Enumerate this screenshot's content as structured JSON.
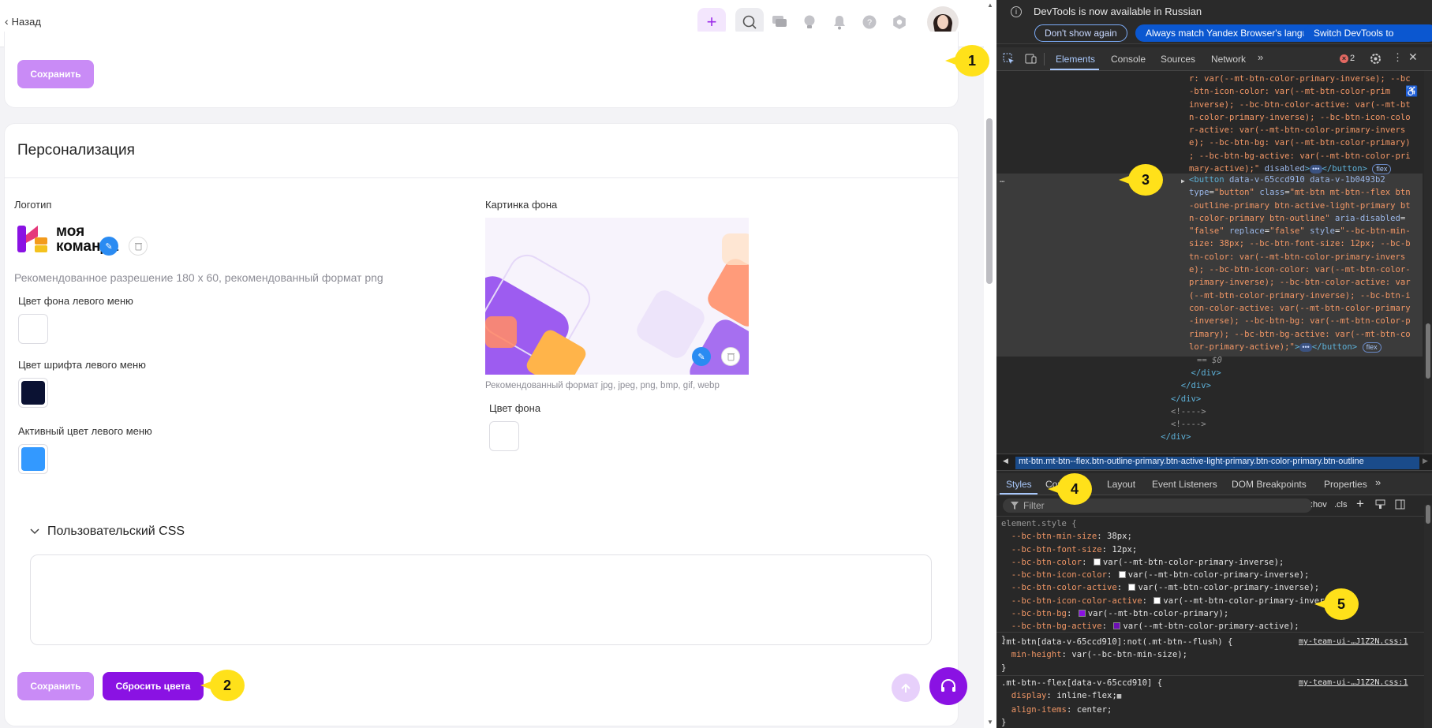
{
  "app": {
    "back_label": "Назад",
    "save_top_label": "Сохранить",
    "section_title": "Персонализация",
    "logo_label": "Логотип",
    "logo_text_line1": "моя",
    "logo_text_line2": "команда",
    "logo_hint": "Рекомендованное разрешение 180 x 60, рекомендованный формат png",
    "left_menu_bg_label": "Цвет фона левого меню",
    "left_menu_font_label": "Цвет шрифта левого меню",
    "left_menu_active_label": "Активный цвет левого меню",
    "bg_image_label": "Картинка фона",
    "bg_image_hint": "Рекомендованный формат jpg, jpeg, png, bmp, gif, webp",
    "bg_color_label": "Цвет фона",
    "custom_css_label": "Пользовательский CSS",
    "save_bottom_label": "Сохранить",
    "reset_colors_label": "Сбросить цвета",
    "colors": {
      "accent": "#8a12e3",
      "accent_light": "#c98bf6",
      "menu_bg": "#ffffff",
      "menu_font": "#0b1233",
      "menu_active": "#3399ff",
      "bg_color": "#ffffff"
    }
  },
  "annotations": [
    "1",
    "2",
    "3",
    "4",
    "5"
  ],
  "devtools": {
    "banner_text": "DevTools is now available in Russian",
    "dont_show": "Don't show again",
    "match_lang": "Always match Yandex Browser's language",
    "switch": "Switch DevTools to",
    "tabs": [
      "Elements",
      "Console",
      "Sources",
      "Network"
    ],
    "error_count": "2",
    "crumb": "mt-btn.mt-btn--flex.btn-outline-primary.btn-active-light-primary.btn-color-primary.btn-outline",
    "style_tabs": [
      "Styles",
      "Computed",
      "Layout",
      "Event Listeners",
      "DOM Breakpoints",
      "Properties"
    ],
    "filter_placeholder": "Filter",
    "hov": ":hov",
    "cls": ".cls",
    "eq": "== $0",
    "source1": "my-team-ui-…J1Z2N.css:1",
    "source2": "my-team-ui-…J1Z2N.css:1"
  }
}
